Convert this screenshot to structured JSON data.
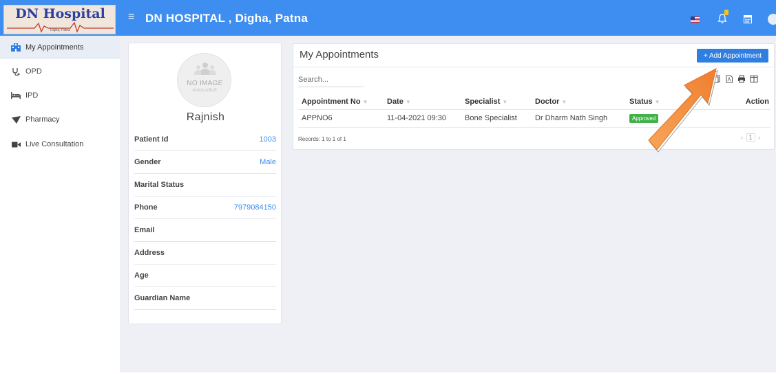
{
  "header": {
    "logo_title": "DN Hospital",
    "logo_subtitle": "Digha, Patna",
    "menu_glyph": "≡",
    "hospital_title": "DN HOSPITAL , Digha, Patna",
    "icons": [
      "us-flag-icon",
      "bell-icon",
      "calendar-icon",
      "user-avatar-icon"
    ],
    "notification_badge_color": "#f5c518"
  },
  "sidebar": {
    "items": [
      {
        "label": "My Appointments",
        "icon": "hospital-icon",
        "active": true
      },
      {
        "label": "OPD",
        "icon": "stethoscope-icon"
      },
      {
        "label": "IPD",
        "icon": "bed-icon"
      },
      {
        "label": "Pharmacy",
        "icon": "pill-icon"
      },
      {
        "label": "Live Consultation",
        "icon": "video-camera-icon"
      }
    ]
  },
  "profile": {
    "no_image_text": "NO IMAGE",
    "no_image_sub": "AVAILABLE",
    "name": "Rajnish",
    "fields": [
      {
        "label": "Patient Id",
        "value": "1003"
      },
      {
        "label": "Gender",
        "value": "Male"
      },
      {
        "label": "Marital Status",
        "value": ""
      },
      {
        "label": "Phone",
        "value": "7979084150"
      },
      {
        "label": "Email",
        "value": ""
      },
      {
        "label": "Address",
        "value": ""
      },
      {
        "label": "Age",
        "value": ""
      },
      {
        "label": "Guardian Name",
        "value": ""
      }
    ]
  },
  "appointments": {
    "title": "My Appointments",
    "add_button_label": "+ Add Appointment",
    "search_placeholder": "Search...",
    "columns": [
      "Appointment No",
      "Date",
      "Specialist",
      "Doctor",
      "Status",
      "Action"
    ],
    "rows": [
      {
        "appointment_no": "APPNO6",
        "date": "11-04-2021 09:30",
        "specialist": "Bone Specialist",
        "doctor": "Dr Dharm Nath Singh",
        "status": "Approved"
      }
    ],
    "records_text": "Records: 1 to 1 of 1",
    "pager": {
      "prev": "‹",
      "page": "1",
      "next": "›"
    },
    "toolbar_icons": [
      "copy-icon",
      "pdf-icon",
      "print-icon",
      "columns-icon"
    ],
    "status_color": "#43b14b"
  },
  "colors": {
    "topbar": "#3d8ef0",
    "accent": "#2f7fe0",
    "content_bg": "#eef0f6",
    "arrow": "#f28c3a"
  }
}
